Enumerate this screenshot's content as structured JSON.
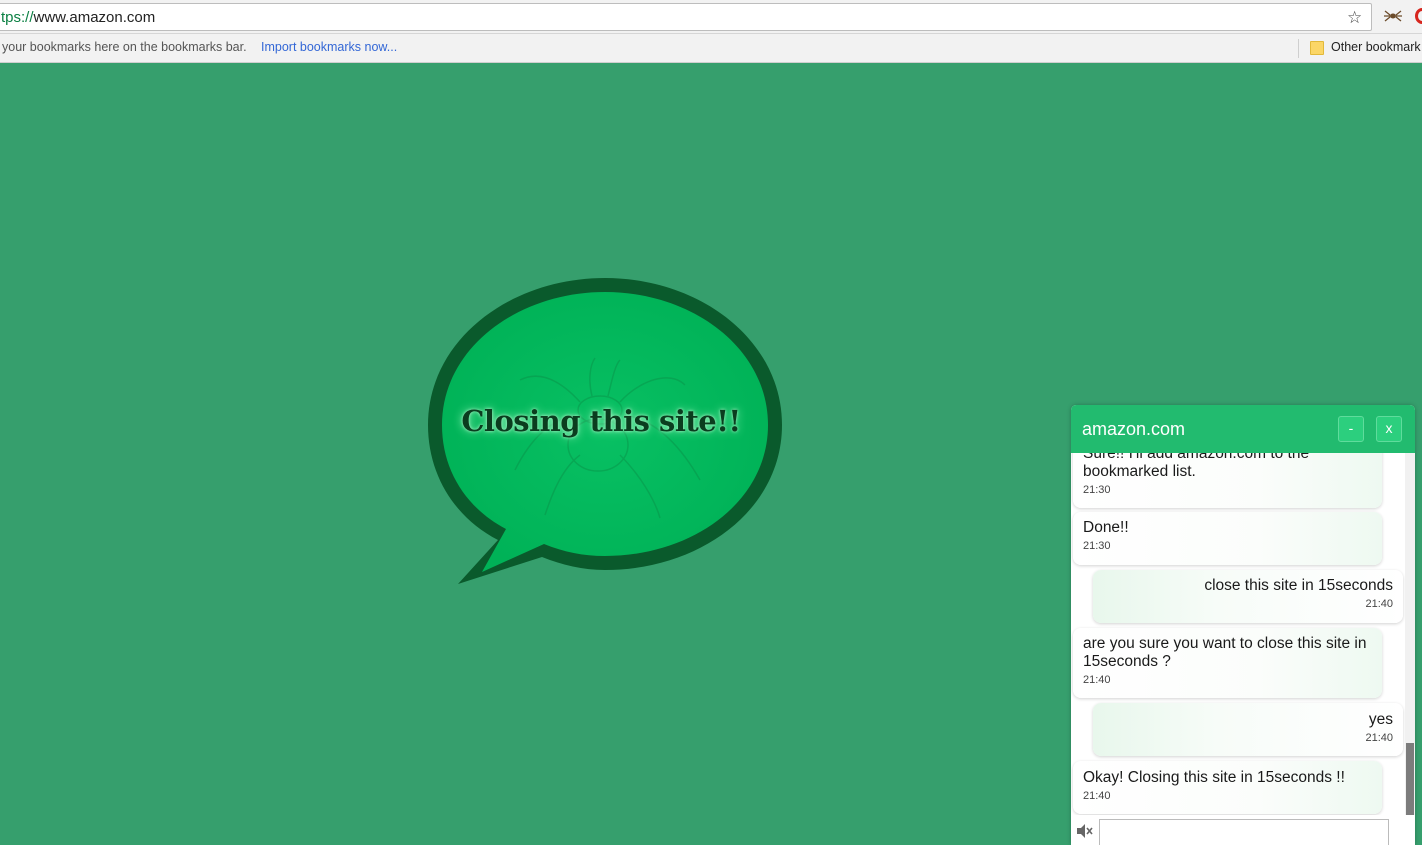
{
  "browser": {
    "url_scheme": "tps://",
    "url_rest": "www.amazon.com",
    "bookmark_hint": "your bookmarks here on the bookmarks bar.",
    "import_link": "Import bookmarks now...",
    "other_bookmarks": "Other bookmark",
    "star_glyph": "☆"
  },
  "bubble": {
    "text": "Closing this site!!",
    "colors": {
      "fill": "#00b35a",
      "outline": "#0a5a2c",
      "background": "#369f6d"
    }
  },
  "chat": {
    "title": "amazon.com",
    "minimize_label": "-",
    "close_label": "x",
    "accent": "#22bb6f",
    "messages": [
      {
        "from": "bot",
        "lines": [
          "Sure!! I'll add amazon.com to the",
          "bookmarked list."
        ],
        "time": "21:30"
      },
      {
        "from": "bot",
        "lines": [
          "Done!!"
        ],
        "time": "21:30"
      },
      {
        "from": "user",
        "lines": [
          "close this site in 15seconds"
        ],
        "time": "21:40"
      },
      {
        "from": "bot",
        "lines": [
          "are you sure you want to close this site in",
          "15seconds ?"
        ],
        "time": "21:40"
      },
      {
        "from": "user",
        "lines": [
          "yes"
        ],
        "time": "21:40"
      },
      {
        "from": "bot",
        "lines": [
          "Okay! Closing this site in 15seconds !!"
        ],
        "time": "21:40"
      }
    ],
    "input_value": "",
    "mute_icon": "speaker-muted-icon"
  }
}
